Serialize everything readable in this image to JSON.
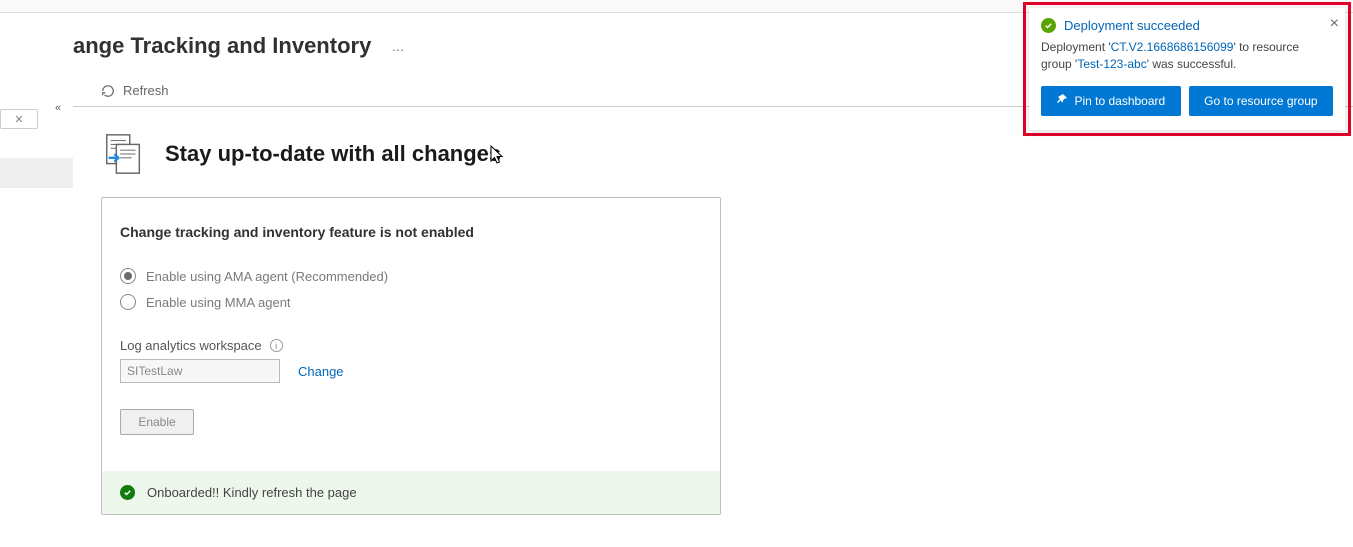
{
  "page": {
    "title": "ange Tracking and Inventory",
    "ellipsis": "…"
  },
  "commands": {
    "refresh": "Refresh"
  },
  "hero": {
    "title": "Stay up-to-date with all changes"
  },
  "card": {
    "heading": "Change tracking and inventory feature is not enabled",
    "option_ama": "Enable using AMA agent (Recommended)",
    "option_mma": "Enable using MMA agent",
    "workspace_label": "Log analytics workspace",
    "workspace_value": "SITestLaw",
    "change_link": "Change",
    "enable_btn": "Enable",
    "status_text": "Onboarded!! Kindly refresh the page"
  },
  "toast": {
    "title": "Deployment succeeded",
    "body_prefix": "Deployment '",
    "deployment_name": "CT.V2.1668686156099",
    "body_mid": "' to resource group '",
    "resource_group": "Test-123-abc",
    "body_suffix": "' was successful.",
    "pin_btn": "Pin to dashboard",
    "goto_btn": "Go to resource group"
  }
}
